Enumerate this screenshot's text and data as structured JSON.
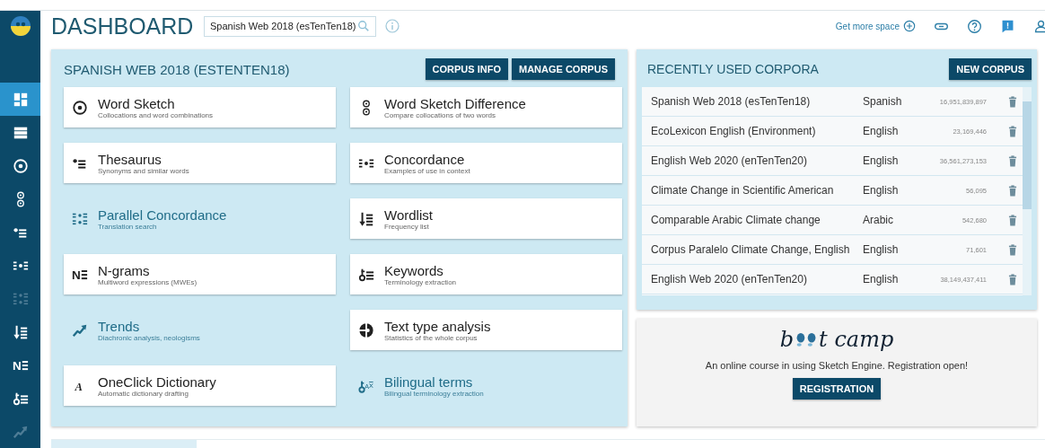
{
  "header": {
    "title": "DASHBOARD",
    "search": {
      "value": "Spanish Web 2018 (esTenTen18)"
    },
    "more_space": "Get more space"
  },
  "sidebar": [
    {
      "kind": "dashboard",
      "selected": true,
      "disabled": false
    },
    {
      "kind": "list",
      "selected": false,
      "disabled": false
    },
    {
      "kind": "word-sketch",
      "selected": false,
      "disabled": false
    },
    {
      "kind": "sketch-difference",
      "selected": false,
      "disabled": false
    },
    {
      "kind": "thesaurus",
      "selected": false,
      "disabled": false
    },
    {
      "kind": "concordance",
      "selected": false,
      "disabled": false
    },
    {
      "kind": "parallel",
      "selected": false,
      "disabled": true
    },
    {
      "kind": "wordlist",
      "selected": false,
      "disabled": false
    },
    {
      "kind": "ngrams",
      "icon_text": "N",
      "selected": false,
      "disabled": false
    },
    {
      "kind": "keywords",
      "selected": false,
      "disabled": false
    },
    {
      "kind": "trends",
      "selected": false,
      "disabled": true
    }
  ],
  "main": {
    "title": "SPANISH WEB 2018 (ESTENTEN18)",
    "buttons": [
      "CORPUS INFO",
      "MANAGE CORPUS"
    ],
    "tools": [
      {
        "kind": "word-sketch",
        "name": "Word Sketch",
        "description": "Collocations and word combinations",
        "available": true
      },
      {
        "kind": "sketch-difference",
        "name": "Word Sketch Difference",
        "description": "Compare collocations of two words",
        "available": true
      },
      {
        "kind": "thesaurus",
        "name": "Thesaurus",
        "description": "Synonyms and similar words",
        "available": true
      },
      {
        "kind": "concordance",
        "name": "Concordance",
        "description": "Examples of use in context",
        "available": true
      },
      {
        "kind": "parallel",
        "name": "Parallel Concordance",
        "description": "Translation search",
        "available": false
      },
      {
        "kind": "wordlist",
        "name": "Wordlist",
        "description": "Frequency list",
        "available": true
      },
      {
        "kind": "ngrams",
        "icon_text": "N",
        "name": "N-grams",
        "description": "Multiword expressions (MWEs)",
        "available": true
      },
      {
        "kind": "keywords",
        "name": "Keywords",
        "description": "Terminology extraction",
        "available": true
      },
      {
        "kind": "trends",
        "name": "Trends",
        "description": "Diachronic analysis, neologisms",
        "available": false
      },
      {
        "kind": "text-type",
        "name": "Text type analysis",
        "description": "Statistics of the whole corpus",
        "available": true
      },
      {
        "kind": "dictionary",
        "icon_text": "A",
        "name": "OneClick Dictionary",
        "description": "Automatic dictionary drafting",
        "available": true
      },
      {
        "kind": "bilingual",
        "icon_text": "A",
        "name": "Bilingual terms",
        "description": "Bilingual terminology extraction",
        "available": false
      }
    ]
  },
  "recent": {
    "title": "RECENTLY USED CORPORA",
    "button": "NEW CORPUS",
    "rows": [
      {
        "name": "Spanish Web 2018 (esTenTen18)",
        "language": "Spanish",
        "size": "16,951,839,897"
      },
      {
        "name": "EcoLexicon English (Environment)",
        "language": "English",
        "size": "23,169,446"
      },
      {
        "name": "English Web 2020 (enTenTen20)",
        "language": "English",
        "size": "36,561,273,153"
      },
      {
        "name": "Climate Change in Scientific American",
        "language": "English",
        "size": "56,095"
      },
      {
        "name": "Comparable Arabic Climate change",
        "language": "Arabic",
        "size": "542,680"
      },
      {
        "name": "Corpus Paralelo Climate Change, English",
        "language": "English",
        "size": "71,601"
      },
      {
        "name": "English Web 2020 (enTenTen20)",
        "language": "English",
        "size": "38,149,437,411"
      }
    ]
  },
  "bootcamp": {
    "logo_start": "b",
    "logo_end": "t camp",
    "text": "An online course in using Sketch Engine. Registration open!",
    "button": "REGISTRATION"
  }
}
